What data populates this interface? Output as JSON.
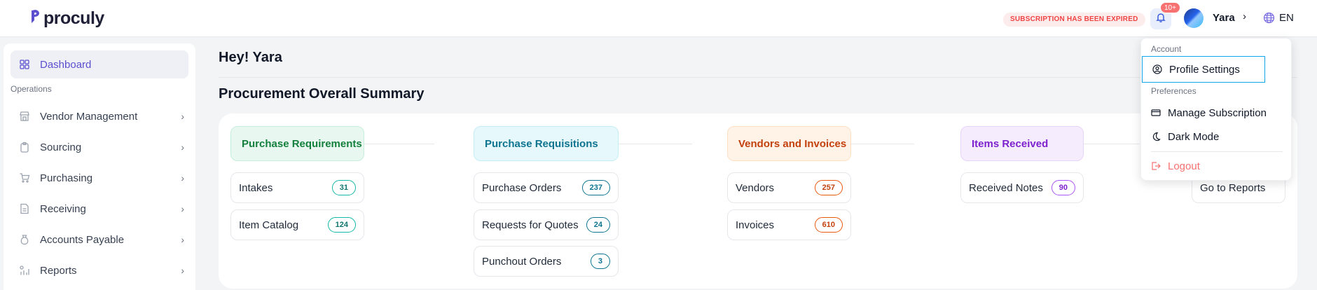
{
  "header": {
    "brand": "proculy",
    "subscription_status": "SUBSCRIPTION HAS BEEN EXPIRED",
    "notifications_badge": "10+",
    "user_name": "Yara",
    "language": "EN",
    "brand_color": "#5b4fcf"
  },
  "sidebar": {
    "dashboard_label": "Dashboard",
    "section_label": "Operations",
    "items": [
      {
        "label": "Vendor Management",
        "icon": "store-icon"
      },
      {
        "label": "Sourcing",
        "icon": "clipboard-icon"
      },
      {
        "label": "Purchasing",
        "icon": "cart-icon"
      },
      {
        "label": "Receiving",
        "icon": "document-icon"
      },
      {
        "label": "Accounts Payable",
        "icon": "money-bag-icon"
      },
      {
        "label": "Reports",
        "icon": "chart-icon"
      }
    ]
  },
  "main": {
    "greeting": "Hey! Yara",
    "summary_title": "Procurement Overall Summary",
    "columns": [
      {
        "title": "Purchase Requirements",
        "color": "#15803d",
        "bg": "#e8f8f1",
        "tiles": [
          {
            "label": "Intakes",
            "count": "31"
          },
          {
            "label": "Item Catalog",
            "count": "124"
          }
        ]
      },
      {
        "title": "Purchase Requisitions",
        "color": "#0e7490",
        "bg": "#e6f8fb",
        "tiles": [
          {
            "label": "Purchase Orders",
            "count": "237"
          },
          {
            "label": "Requests for Quotes",
            "count": "24"
          },
          {
            "label": "Punchout Orders",
            "count": "3"
          }
        ]
      },
      {
        "title": "Vendors and Invoices",
        "color": "#c2410c",
        "bg": "#fff3e8",
        "tiles": [
          {
            "label": "Vendors",
            "count": "257"
          },
          {
            "label": "Invoices",
            "count": "610"
          }
        ]
      },
      {
        "title": "Items Received",
        "color": "#7e22ce",
        "bg": "#f5edfd",
        "tiles": [
          {
            "label": "Received Notes",
            "count": "90"
          }
        ]
      }
    ],
    "reports_link": "Go to Reports"
  },
  "dropdown": {
    "account_section": "Account",
    "profile_settings": "Profile Settings",
    "preferences_section": "Preferences",
    "manage_subscription": "Manage Subscription",
    "dark_mode": "Dark Mode",
    "logout": "Logout"
  }
}
